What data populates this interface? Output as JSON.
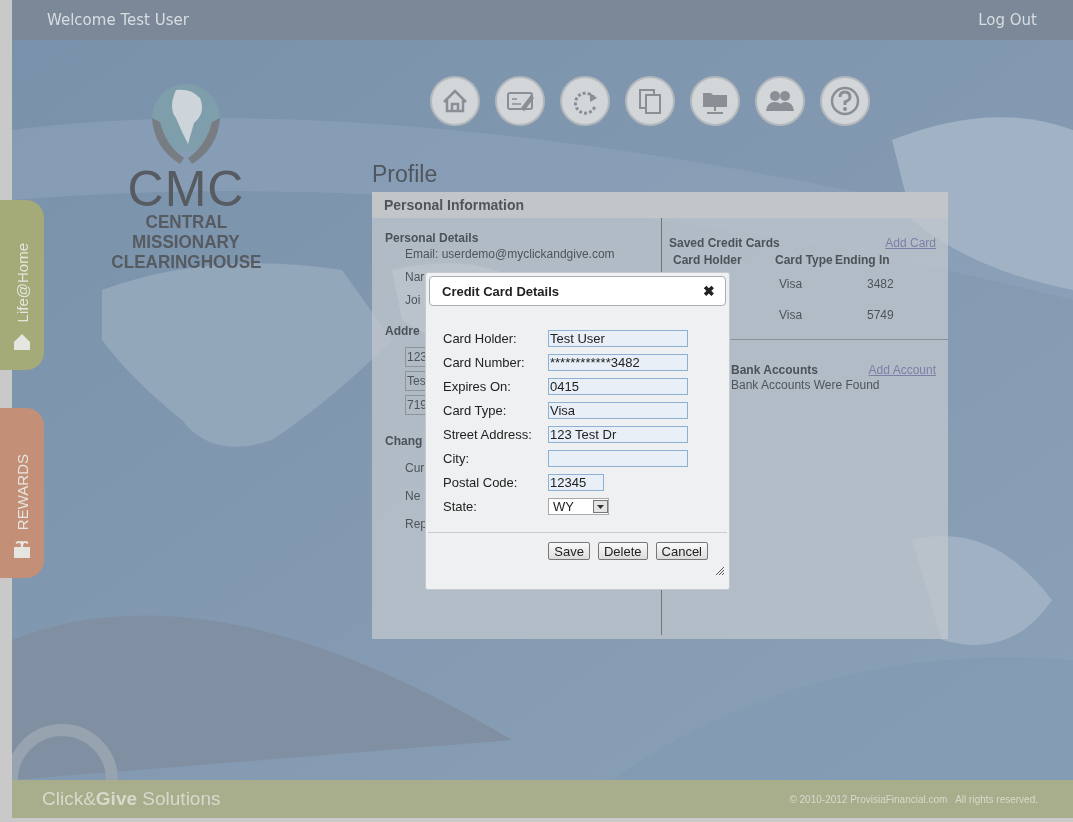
{
  "header": {
    "welcome": "Welcome Test User",
    "logout": "Log Out"
  },
  "side_tabs": [
    {
      "label": "Life@Home",
      "kind": "home",
      "color": "#a4ab78"
    },
    {
      "label": "REWARDS",
      "kind": "rewards",
      "color": "#c48f77"
    }
  ],
  "logo": {
    "acronym": "CMC",
    "name_lines": [
      "CENTRAL",
      "MISSIONARY",
      "CLEARINGHOUSE"
    ]
  },
  "nav": [
    {
      "kind": "home"
    },
    {
      "kind": "cheque"
    },
    {
      "kind": "refresh"
    },
    {
      "kind": "copy"
    },
    {
      "kind": "folder"
    },
    {
      "kind": "people"
    },
    {
      "kind": "help"
    }
  ],
  "page_title": "Profile",
  "panel": {
    "title": "Personal Information",
    "personal": {
      "heading": "Personal Details",
      "email": "Email: userdemo@myclickandgive.com",
      "lines": [
        "Nar",
        "Joi"
      ]
    },
    "address": {
      "heading": "Addre",
      "fields": [
        "123",
        "Tes",
        "719"
      ]
    },
    "password": {
      "heading": "Chang",
      "labels": [
        "Cur",
        "Ne",
        "Rep"
      ]
    },
    "cards": {
      "heading": "Saved Credit Cards",
      "link": "Add Card",
      "columns": [
        "Card Holder",
        "Card Type",
        "Ending In"
      ],
      "rows": [
        {
          "card_type": "Visa",
          "ending": "3482"
        },
        {
          "card_type": "Visa",
          "ending": "5749"
        }
      ]
    },
    "bank": {
      "heading": "Bank Accounts",
      "link": "Add Account",
      "message": "Bank Accounts Were Found"
    }
  },
  "dialog": {
    "title": "Credit Card Details",
    "close": "✖",
    "fields": [
      {
        "label": "Card Holder:",
        "kind": "text",
        "value": "Test User"
      },
      {
        "label": "Card Number:",
        "kind": "text",
        "value": "************3482"
      },
      {
        "label": "Expires On:",
        "kind": "text",
        "value": "0415"
      },
      {
        "label": "Card Type:",
        "kind": "text",
        "value": "Visa"
      },
      {
        "label": "Street Address:",
        "kind": "text",
        "value": "123 Test Dr"
      },
      {
        "label": "City:",
        "kind": "text"
      },
      {
        "label": "Postal Code:",
        "kind": "short",
        "value": "12345"
      },
      {
        "label": "State:",
        "kind": "select",
        "value": "WY"
      }
    ],
    "buttons": [
      "Save",
      "Delete",
      "Cancel"
    ]
  },
  "footer": {
    "brand": "Click&**Give** Solutions",
    "copyright": "© 2010-2012 ProvisiaFinancial.com   All rights reserved."
  }
}
